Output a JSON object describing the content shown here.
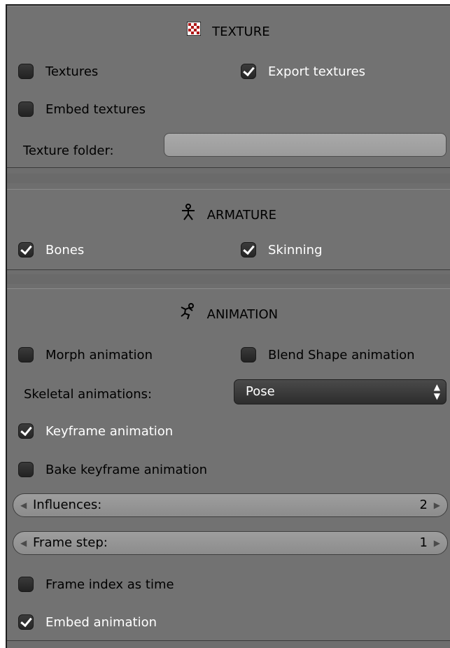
{
  "texture": {
    "title": "TEXTURE",
    "textures_label": "Textures",
    "export_textures_label": "Export textures",
    "embed_textures_label": "Embed textures",
    "texture_folder_label": "Texture folder:",
    "texture_folder_value": ""
  },
  "armature": {
    "title": "ARMATURE",
    "bones_label": "Bones",
    "skinning_label": "Skinning"
  },
  "animation": {
    "title": "ANIMATION",
    "morph_label": "Morph animation",
    "blend_shape_label": "Blend Shape animation",
    "skeletal_label": "Skeletal animations:",
    "skeletal_value": "Pose",
    "keyframe_label": "Keyframe animation",
    "bake_keyframe_label": "Bake keyframe animation",
    "influences_label": "Influences:",
    "influences_value": "2",
    "frame_step_label": "Frame step:",
    "frame_step_value": "1",
    "frame_index_label": "Frame index as time",
    "embed_animation_label": "Embed animation"
  },
  "checked": {
    "textures": false,
    "export_textures": true,
    "embed_textures": false,
    "bones": true,
    "skinning": true,
    "morph": false,
    "blend_shape": false,
    "keyframe": true,
    "bake_keyframe": false,
    "frame_index": false,
    "embed_animation": true
  },
  "colors": {
    "panel_bg": "#727272",
    "checkbox_bg": "#2a2a2a",
    "field_bg": "#a5a5a5",
    "select_bg": "#333333"
  },
  "icons": {
    "texture": "checker-texture-icon",
    "armature": "armature-figure-icon",
    "animation": "running-figure-icon",
    "select": "up-down-arrows-icon",
    "decrement": "left-arrow-icon",
    "increment": "right-arrow-icon"
  }
}
